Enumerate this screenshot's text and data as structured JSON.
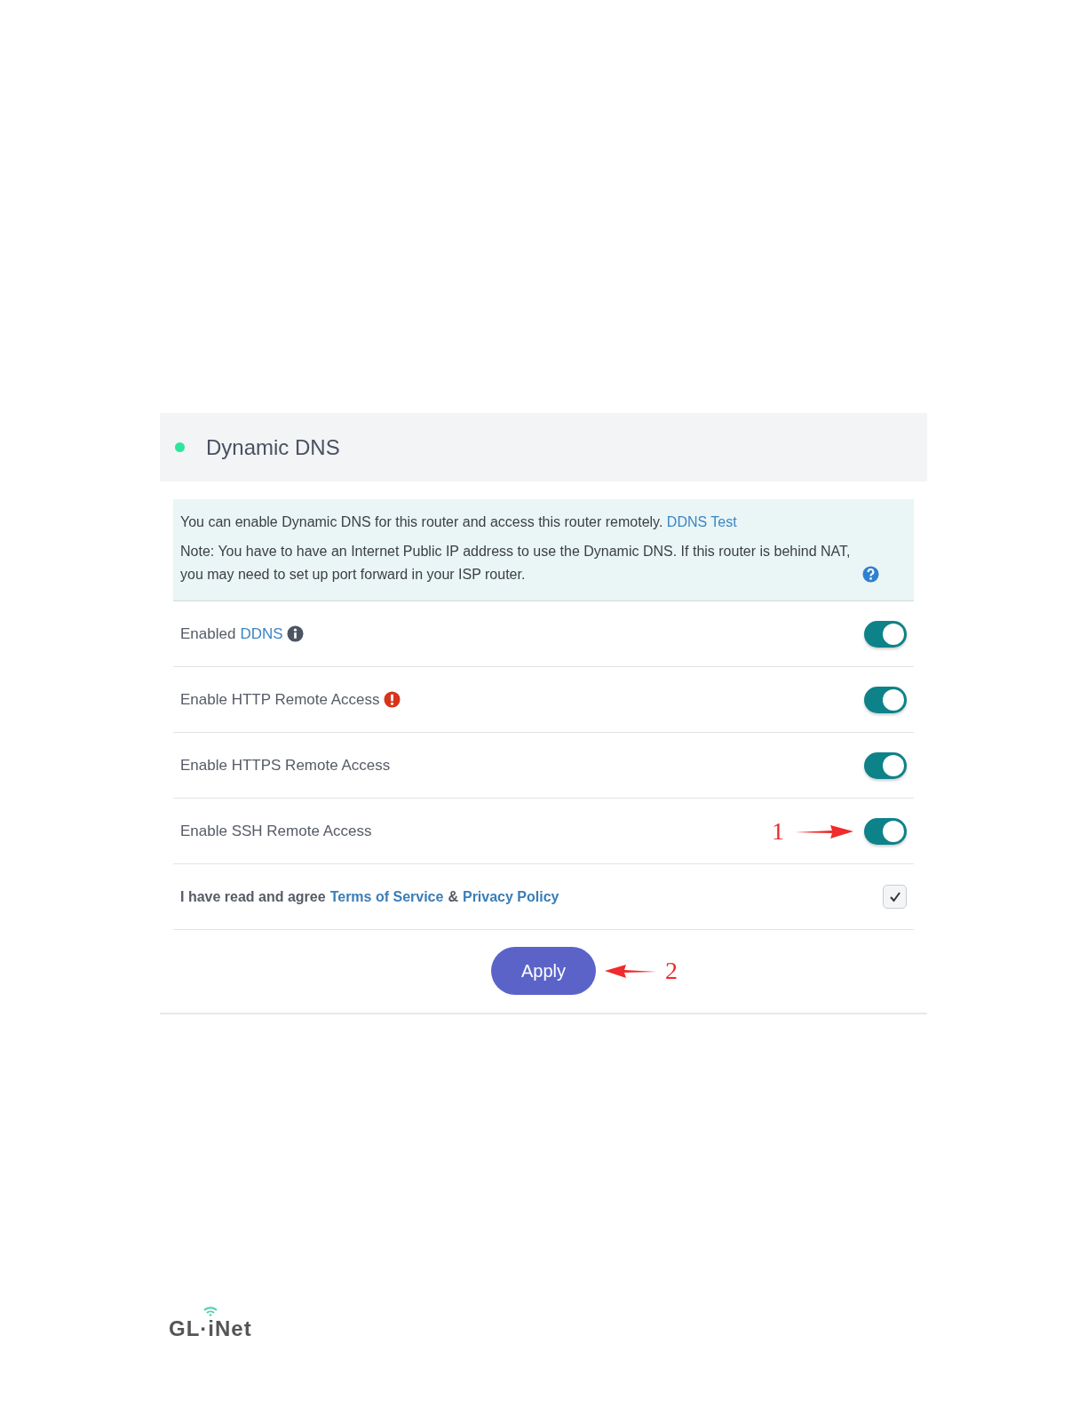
{
  "section": {
    "title": "Dynamic DNS"
  },
  "notice": {
    "text": "You can enable Dynamic DNS for this router and access this router remotely.",
    "link": "DDNS Test",
    "note": "Note: You have to have an Internet Public IP address to use the Dynamic DNS. If this router is behind NAT, you may need to set up port forward in your ISP router."
  },
  "settings": [
    {
      "kind": "info",
      "label": "Enabled",
      "link": "DDNS",
      "on": true
    },
    {
      "kind": "warning",
      "label": "Enable HTTP Remote Access",
      "on": true
    },
    {
      "kind": "plain",
      "label": "Enable HTTPS Remote Access",
      "on": true
    },
    {
      "kind": "plain",
      "label": "Enable SSH Remote Access",
      "on": true,
      "annotation": "1"
    }
  ],
  "agreement": {
    "text": "I have read and agree",
    "terms": "Terms of Service",
    "joiner": "&",
    "privacy": "Privacy Policy",
    "checked": true
  },
  "apply": {
    "label": "Apply",
    "annotation": "2"
  },
  "footer": {
    "logo": "GL·iNet"
  }
}
